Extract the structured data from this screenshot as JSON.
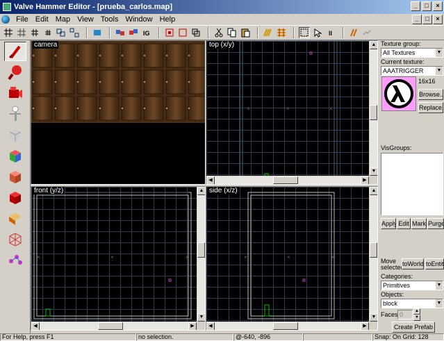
{
  "window": {
    "title": "Valve Hammer Editor - [prueba_carlos.map]",
    "minimize": "_",
    "maximize": "□",
    "close": "×"
  },
  "menu": [
    {
      "label": "File"
    },
    {
      "label": "Edit"
    },
    {
      "label": "Map"
    },
    {
      "label": "View"
    },
    {
      "label": "Tools"
    },
    {
      "label": "Window"
    },
    {
      "label": "Help"
    }
  ],
  "viewports": {
    "camera": "camera",
    "top": "top (x/y)",
    "front": "front (y/z)",
    "side": "side (x/z)"
  },
  "texture": {
    "group_label": "Texture group:",
    "group_value": "All Textures",
    "current_label": "Current texture:",
    "current_value": "AAATRIGGER",
    "size": "16x16",
    "browse_button": "Browse...",
    "replace_button": "Replace..."
  },
  "visgroups": {
    "label": "VisGroups:",
    "apply_button": "Apply",
    "edit_button": "Edit",
    "mark_button": "Mark",
    "purge_button": "Purge"
  },
  "objects": {
    "move_selected": "Move selected:",
    "to_world_button": "toWorld",
    "to_entity_button": "toEntity",
    "categories_label": "Categories:",
    "categories_value": "Primitives",
    "objects_label": "Objects:",
    "objects_value": "block",
    "faces_label": "Faces:",
    "faces_value": "0",
    "create_prefab_button": "Create Prefab"
  },
  "status": {
    "help": "For Help, press F1",
    "selection": "no selection.",
    "coords": "@-640, -896",
    "snap": "Snap: On Grid: 128"
  },
  "colors": {
    "titlebar_start": "#0a246a",
    "titlebar_end": "#a6caf0",
    "grid": "#2a3f55",
    "selection_magenta": "#c03cc0",
    "entity_green": "#00c000"
  }
}
